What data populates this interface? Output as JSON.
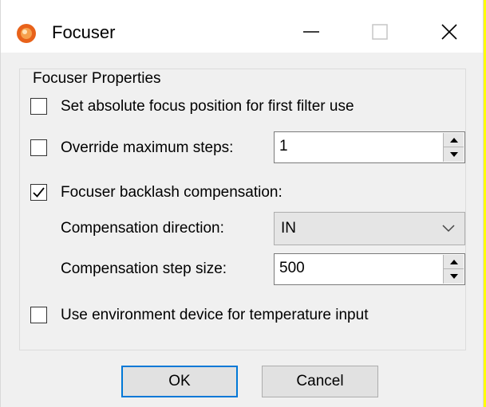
{
  "window": {
    "title": "Focuser",
    "icon": "app-icon",
    "controls": [
      "minimize-icon",
      "maximize-icon",
      "close-icon"
    ]
  },
  "group": {
    "title": "Focuser Properties"
  },
  "options": {
    "absolute_focus": {
      "label": "Set absolute focus position for first filter use",
      "checked": false
    },
    "override_max": {
      "label": "Override maximum steps:",
      "checked": false,
      "value": "1"
    },
    "backlash": {
      "label": "Focuser backlash compensation:",
      "checked": true
    },
    "direction": {
      "label": "Compensation direction:",
      "value": "IN"
    },
    "step_size": {
      "label": "Compensation step size:",
      "value": "500"
    },
    "env_device": {
      "label": "Use environment device for temperature input",
      "checked": false
    }
  },
  "buttons": {
    "ok": "OK",
    "cancel": "Cancel"
  },
  "colors": {
    "accent": "#0078d7",
    "background_outside": "#ffff00"
  }
}
